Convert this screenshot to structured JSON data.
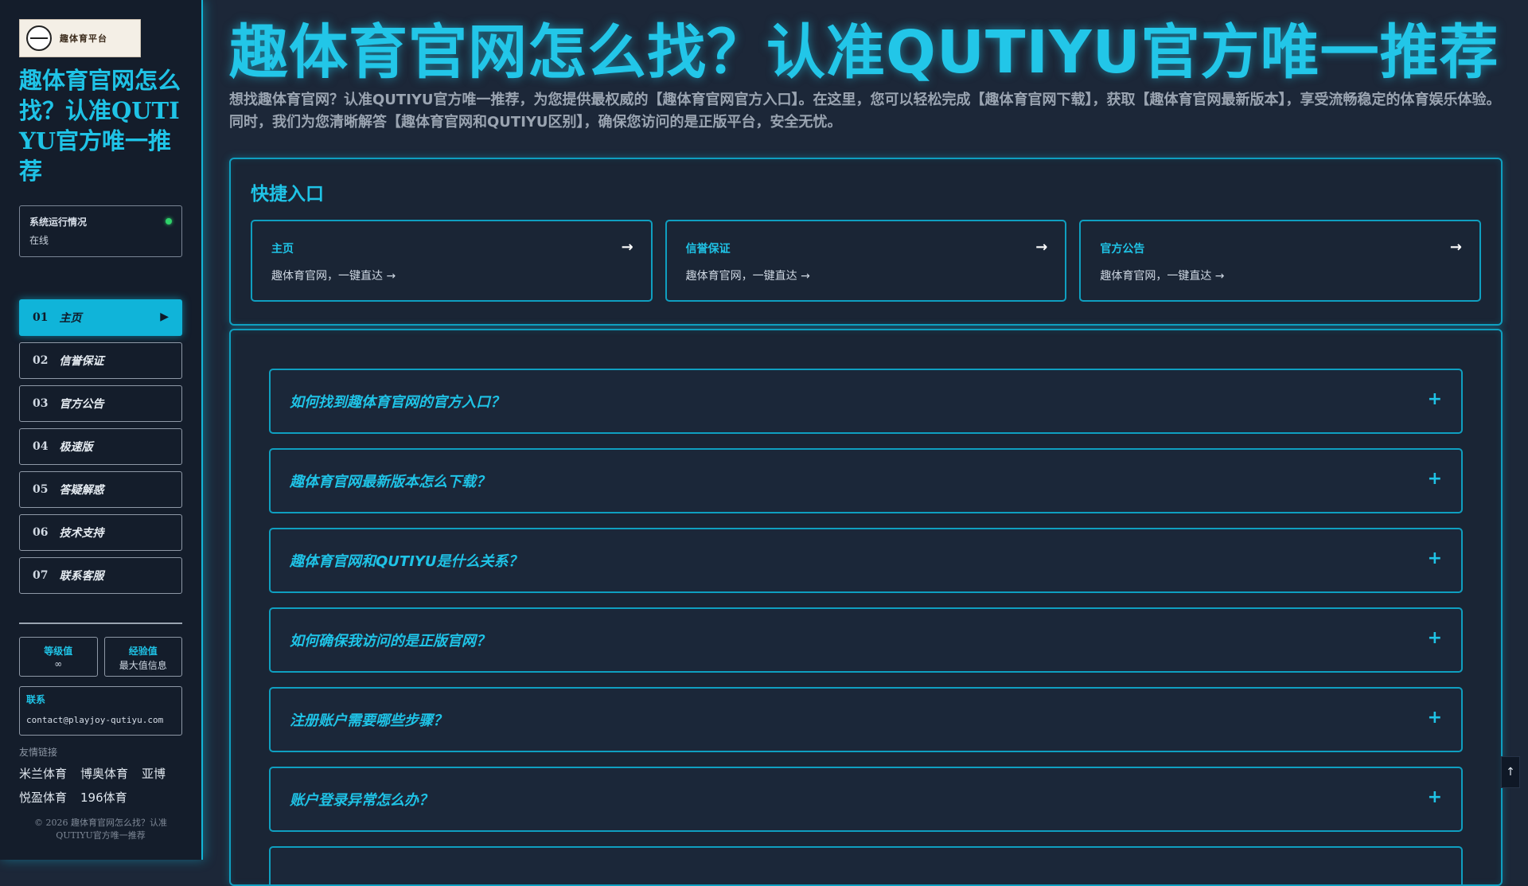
{
  "sidebar": {
    "logo_text": "趣体育平台",
    "title": "趣体育官网怎么找？认准QUTIYU官方唯一推荐",
    "status": {
      "label": "系统运行情况",
      "value": "在线"
    },
    "nav": [
      {
        "num": "01",
        "label": "主页",
        "active": true
      },
      {
        "num": "02",
        "label": "信誉保证",
        "active": false
      },
      {
        "num": "03",
        "label": "官方公告",
        "active": false
      },
      {
        "num": "04",
        "label": "极速版",
        "active": false
      },
      {
        "num": "05",
        "label": "答疑解惑",
        "active": false
      },
      {
        "num": "06",
        "label": "技术支持",
        "active": false
      },
      {
        "num": "07",
        "label": "联系客服",
        "active": false
      }
    ],
    "nav_arrow": "▶",
    "stats": [
      {
        "label": "等级值",
        "value": "∞"
      },
      {
        "label": "经验值",
        "value": "最大值信息"
      }
    ],
    "contact": {
      "label": "联系",
      "email": "contact@playjoy-qutiyu.com"
    },
    "links_label": "友情链接",
    "links": [
      "米兰体育",
      "博奥体育",
      "亚博",
      "悦盈体育",
      "196体育"
    ],
    "copyright": "© 2026 趣体育官网怎么找？认准QUTIYU官方唯一推荐"
  },
  "main": {
    "title": "趣体育官网怎么找？认准QUTIYU官方唯一推荐",
    "description": "想找趣体育官网？认准QUTIYU官方唯一推荐，为您提供最权威的【趣体育官网官方入口】。在这里，您可以轻松完成【趣体育官网下载】，获取【趣体育官网最新版本】，享受流畅稳定的体育娱乐体验。同时，我们为您清晰解答【趣体育官网和QUTIYU区别】，确保您访问的是正版平台，安全无忧。",
    "quick": {
      "title": "快捷入口",
      "arrow": "→",
      "cards": [
        {
          "title": "主页",
          "sub": "趣体育官网，一键直达 →"
        },
        {
          "title": "信誉保证",
          "sub": "趣体育官网，一键直达 →"
        },
        {
          "title": "官方公告",
          "sub": "趣体育官网，一键直达 →"
        }
      ]
    },
    "faq": {
      "toggle": "+",
      "items": [
        "如何找到趣体育官网的官方入口？",
        "趣体育官网最新版本怎么下载？",
        "趣体育官网和QUTIYU是什么关系？",
        "如何确保我访问的是正版官网？",
        "注册账户需要哪些步骤？",
        "账户登录异常怎么办？",
        ""
      ]
    }
  },
  "scroll_top": "↑",
  "colors": {
    "accent": "#1fc3e6",
    "background": "#1c2738",
    "sidebar": "#141d2b",
    "status_online": "#2fd36a"
  }
}
